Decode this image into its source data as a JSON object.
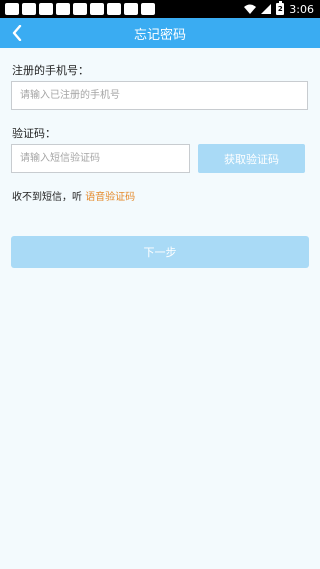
{
  "status_bar": {
    "time": "3:06",
    "battery_level": "2",
    "icons": [
      "notification-icon",
      "wifi-icon",
      "battery-icon"
    ]
  },
  "header": {
    "title": "忘记密码",
    "back_icon": "chevron-left-icon"
  },
  "form": {
    "phone_label": "注册的手机号：",
    "phone_placeholder": "请输入已注册的手机号",
    "phone_value": "",
    "code_label": "验证码：",
    "code_placeholder": "请输入短信验证码",
    "code_value": "",
    "get_code_label": "获取验证码",
    "no_sms_text": "收不到短信，听",
    "voice_code_link": "语音验证码",
    "next_label": "下一步"
  },
  "colors": {
    "header_bg": "#3aacf2",
    "page_bg": "#f3fafd",
    "disabled_button": "#a9daf6",
    "link": "#e58a2b"
  }
}
